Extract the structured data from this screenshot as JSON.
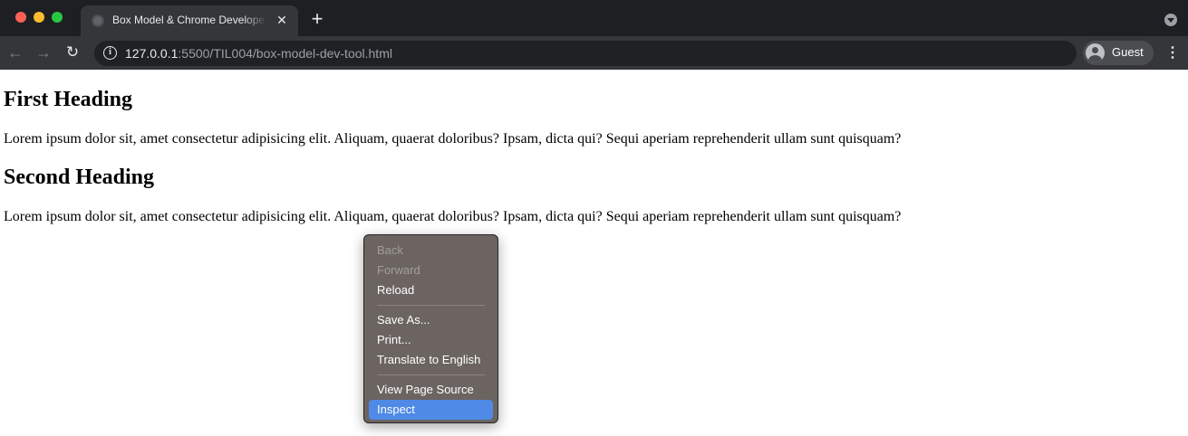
{
  "browser": {
    "tab": {
      "title": "Box Model & Chrome Developer Tools",
      "close_glyph": "✕"
    },
    "new_tab_glyph": "+",
    "nav": {
      "back_glyph": "←",
      "forward_glyph": "→",
      "reload_glyph": "↻"
    },
    "url": {
      "host": "127.0.0.1",
      "rest": ":5500/TIL004/box-model-dev-tool.html"
    },
    "info_glyph": "i",
    "profile": {
      "label": "Guest"
    },
    "menu_glyph": "⋮"
  },
  "page": {
    "heading1": "First Heading",
    "paragraph1": "Lorem ipsum dolor sit, amet consectetur adipisicing elit. Aliquam, quaerat doloribus? Ipsam, dicta qui? Sequi aperiam reprehenderit ullam sunt quisquam?",
    "heading2": "Second Heading",
    "paragraph2": "Lorem ipsum dolor sit, amet consectetur adipisicing elit. Aliquam, quaerat doloribus? Ipsam, dicta qui? Sequi aperiam reprehenderit ullam sunt quisquam?"
  },
  "context_menu": {
    "items": [
      {
        "label": "Back",
        "disabled": true
      },
      {
        "label": "Forward",
        "disabled": true
      },
      {
        "label": "Reload",
        "disabled": false
      },
      {
        "label": "Save As...",
        "disabled": false
      },
      {
        "label": "Print...",
        "disabled": false
      },
      {
        "label": "Translate to English",
        "disabled": false
      },
      {
        "label": "View Page Source",
        "disabled": false
      },
      {
        "label": "Inspect",
        "disabled": false,
        "highlighted": true
      }
    ]
  },
  "colors": {
    "titlebar": "#1e1f22",
    "toolbar": "#35363a",
    "menu_bg": "#6b6461",
    "menu_highlight": "#4e8ae6"
  },
  "icons": {
    "favicon": "globe-icon",
    "info": "info-icon",
    "avatar": "person-icon"
  }
}
